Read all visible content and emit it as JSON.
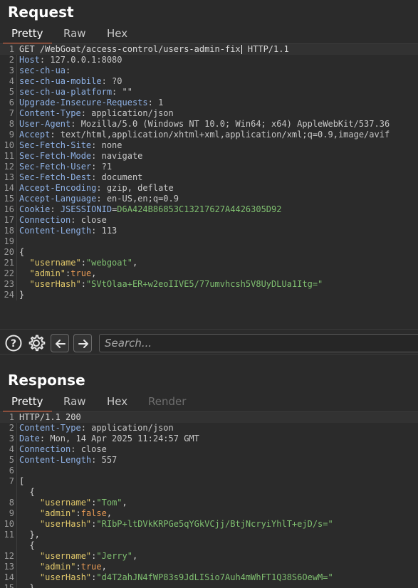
{
  "request": {
    "title": "Request",
    "tabs": [
      {
        "label": "Pretty",
        "active": true
      },
      {
        "label": "Raw",
        "active": false
      },
      {
        "label": "Hex",
        "active": false
      }
    ],
    "lines": [
      {
        "n": "1",
        "parts": [
          {
            "t": "GET /WebGoat/access-control/users-admin-fix",
            "c": "plain"
          },
          {
            "caret": true
          },
          {
            "t": " HTTP/1.1",
            "c": "plain"
          }
        ]
      },
      {
        "n": "2",
        "parts": [
          {
            "t": "Host",
            "c": "hn"
          },
          {
            "t": ": 127.0.0.1:8080",
            "c": "hv"
          }
        ]
      },
      {
        "n": "3",
        "parts": [
          {
            "t": "sec-ch-ua",
            "c": "hn"
          },
          {
            "t": ":",
            "c": "hv"
          }
        ]
      },
      {
        "n": "4",
        "parts": [
          {
            "t": "sec-ch-ua-mobile",
            "c": "hn"
          },
          {
            "t": ": ?0",
            "c": "hv"
          }
        ]
      },
      {
        "n": "5",
        "parts": [
          {
            "t": "sec-ch-ua-platform",
            "c": "hn"
          },
          {
            "t": ": \"\"",
            "c": "hv"
          }
        ]
      },
      {
        "n": "6",
        "parts": [
          {
            "t": "Upgrade-Insecure-Requests",
            "c": "hn"
          },
          {
            "t": ": 1",
            "c": "hv"
          }
        ]
      },
      {
        "n": "7",
        "parts": [
          {
            "t": "Content-Type",
            "c": "hn"
          },
          {
            "t": ": application/json",
            "c": "hv"
          }
        ]
      },
      {
        "n": "8",
        "parts": [
          {
            "t": "User-Agent",
            "c": "hn"
          },
          {
            "t": ": Mozilla/5.0 (Windows NT 10.0; Win64; x64) AppleWebKit/537.36",
            "c": "hv"
          }
        ]
      },
      {
        "n": "9",
        "parts": [
          {
            "t": "Accept",
            "c": "hn"
          },
          {
            "t": ": text/html,application/xhtml+xml,application/xml;q=0.9,image/avif",
            "c": "hv"
          }
        ]
      },
      {
        "n": "10",
        "parts": [
          {
            "t": "Sec-Fetch-Site",
            "c": "hn"
          },
          {
            "t": ": none",
            "c": "hv"
          }
        ]
      },
      {
        "n": "11",
        "parts": [
          {
            "t": "Sec-Fetch-Mode",
            "c": "hn"
          },
          {
            "t": ": navigate",
            "c": "hv"
          }
        ]
      },
      {
        "n": "12",
        "parts": [
          {
            "t": "Sec-Fetch-User",
            "c": "hn"
          },
          {
            "t": ": ?1",
            "c": "hv"
          }
        ]
      },
      {
        "n": "13",
        "parts": [
          {
            "t": "Sec-Fetch-Dest",
            "c": "hn"
          },
          {
            "t": ": document",
            "c": "hv"
          }
        ]
      },
      {
        "n": "14",
        "parts": [
          {
            "t": "Accept-Encoding",
            "c": "hn"
          },
          {
            "t": ": gzip, deflate",
            "c": "hv"
          }
        ]
      },
      {
        "n": "15",
        "parts": [
          {
            "t": "Accept-Language",
            "c": "hn"
          },
          {
            "t": ": en-US,en;q=0.9",
            "c": "hv"
          }
        ]
      },
      {
        "n": "16",
        "parts": [
          {
            "t": "Cookie",
            "c": "hn"
          },
          {
            "t": ": ",
            "c": "hv"
          },
          {
            "t": "JSESSIONID",
            "c": "ck"
          },
          {
            "t": "=",
            "c": "hv"
          },
          {
            "t": "D6A424B86853C13217627A4426305D92",
            "c": "cv"
          }
        ]
      },
      {
        "n": "17",
        "parts": [
          {
            "t": "Connection",
            "c": "hn"
          },
          {
            "t": ": close",
            "c": "hv"
          }
        ]
      },
      {
        "n": "18",
        "parts": [
          {
            "t": "Content-Length",
            "c": "hn"
          },
          {
            "t": ": 113",
            "c": "hv"
          }
        ]
      },
      {
        "n": "19",
        "parts": []
      },
      {
        "n": "20",
        "parts": [
          {
            "t": "{",
            "c": "jp"
          }
        ]
      },
      {
        "n": "21",
        "parts": [
          {
            "t": "  ",
            "c": "jp"
          },
          {
            "t": "\"username\"",
            "c": "jk"
          },
          {
            "t": ":",
            "c": "jp"
          },
          {
            "t": "\"webgoat\"",
            "c": "js"
          },
          {
            "t": ",",
            "c": "jp"
          }
        ]
      },
      {
        "n": "22",
        "parts": [
          {
            "t": "  ",
            "c": "jp"
          },
          {
            "t": "\"admin\"",
            "c": "jk"
          },
          {
            "t": ":",
            "c": "jp"
          },
          {
            "t": "true",
            "c": "jb"
          },
          {
            "t": ",",
            "c": "jp"
          }
        ]
      },
      {
        "n": "23",
        "parts": [
          {
            "t": "  ",
            "c": "jp"
          },
          {
            "t": "\"userHash\"",
            "c": "jk"
          },
          {
            "t": ":",
            "c": "jp"
          },
          {
            "t": "\"SVtOlaa+ER+w2eoIIVE5/77umvhcsh5V8UyDLUa1Itg=\"",
            "c": "js"
          }
        ]
      },
      {
        "n": "24",
        "parts": [
          {
            "t": "}",
            "c": "jp"
          }
        ]
      }
    ]
  },
  "toolbar": {
    "help_icon": "help-icon",
    "settings_icon": "gear-icon",
    "back_icon": "arrow-left-icon",
    "forward_icon": "arrow-right-icon",
    "search_placeholder": "Search..."
  },
  "response": {
    "title": "Response",
    "tabs": [
      {
        "label": "Pretty",
        "active": true
      },
      {
        "label": "Raw",
        "active": false
      },
      {
        "label": "Hex",
        "active": false
      },
      {
        "label": "Render",
        "active": false,
        "disabled": true
      }
    ],
    "lines": [
      {
        "n": "1",
        "parts": [
          {
            "t": "HTTP/1.1 200",
            "c": "plain"
          }
        ]
      },
      {
        "n": "2",
        "parts": [
          {
            "t": "Content-Type",
            "c": "hn"
          },
          {
            "t": ": application/json",
            "c": "hv"
          }
        ]
      },
      {
        "n": "3",
        "parts": [
          {
            "t": "Date",
            "c": "hn"
          },
          {
            "t": ": Mon, 14 Apr 2025 11:24:57 GMT",
            "c": "hv"
          }
        ]
      },
      {
        "n": "4",
        "parts": [
          {
            "t": "Connection",
            "c": "hn"
          },
          {
            "t": ": close",
            "c": "hv"
          }
        ]
      },
      {
        "n": "5",
        "parts": [
          {
            "t": "Content-Length",
            "c": "hn"
          },
          {
            "t": ": 557",
            "c": "hv"
          }
        ]
      },
      {
        "n": "6",
        "parts": []
      },
      {
        "n": "7",
        "parts": [
          {
            "t": "[",
            "c": "jp"
          }
        ]
      },
      {
        "n": "",
        "parts": [
          {
            "t": "  {",
            "c": "jp"
          }
        ]
      },
      {
        "n": "8",
        "parts": [
          {
            "t": "    ",
            "c": "jp"
          },
          {
            "t": "\"username\"",
            "c": "jk"
          },
          {
            "t": ":",
            "c": "jp"
          },
          {
            "t": "\"Tom\"",
            "c": "js"
          },
          {
            "t": ",",
            "c": "jp"
          }
        ]
      },
      {
        "n": "9",
        "parts": [
          {
            "t": "    ",
            "c": "jp"
          },
          {
            "t": "\"admin\"",
            "c": "jk"
          },
          {
            "t": ":",
            "c": "jp"
          },
          {
            "t": "false",
            "c": "jb"
          },
          {
            "t": ",",
            "c": "jp"
          }
        ]
      },
      {
        "n": "10",
        "parts": [
          {
            "t": "    ",
            "c": "jp"
          },
          {
            "t": "\"userHash\"",
            "c": "jk"
          },
          {
            "t": ":",
            "c": "jp"
          },
          {
            "t": "\"RIbP+ltDVkKRPGe5qYGkVCjj/BtjNcryiYhlT+ejD/s=\"",
            "c": "js"
          }
        ]
      },
      {
        "n": "11",
        "parts": [
          {
            "t": "  },",
            "c": "jp"
          }
        ]
      },
      {
        "n": "",
        "parts": [
          {
            "t": "  {",
            "c": "jp"
          }
        ]
      },
      {
        "n": "12",
        "parts": [
          {
            "t": "    ",
            "c": "jp"
          },
          {
            "t": "\"username\"",
            "c": "jk"
          },
          {
            "t": ":",
            "c": "jp"
          },
          {
            "t": "\"Jerry\"",
            "c": "js"
          },
          {
            "t": ",",
            "c": "jp"
          }
        ]
      },
      {
        "n": "13",
        "parts": [
          {
            "t": "    ",
            "c": "jp"
          },
          {
            "t": "\"admin\"",
            "c": "jk"
          },
          {
            "t": ":",
            "c": "jp"
          },
          {
            "t": "true",
            "c": "jb"
          },
          {
            "t": ",",
            "c": "jp"
          }
        ]
      },
      {
        "n": "14",
        "parts": [
          {
            "t": "    ",
            "c": "jp"
          },
          {
            "t": "\"userHash\"",
            "c": "jk"
          },
          {
            "t": ":",
            "c": "jp"
          },
          {
            "t": "\"d4T2ahJN4fWP83s9JdLISio7Auh4mWhFT1Q38S6OewM=\"",
            "c": "js"
          }
        ]
      },
      {
        "n": "15",
        "parts": [
          {
            "t": "  },",
            "c": "jp"
          }
        ]
      }
    ]
  },
  "colors": {
    "background": "#2b2b2b",
    "accent": "#e8663d",
    "header_name": "#8fb2e6",
    "json_key": "#e2c96b",
    "json_string": "#7fbf70",
    "json_bool": "#e89a55"
  }
}
